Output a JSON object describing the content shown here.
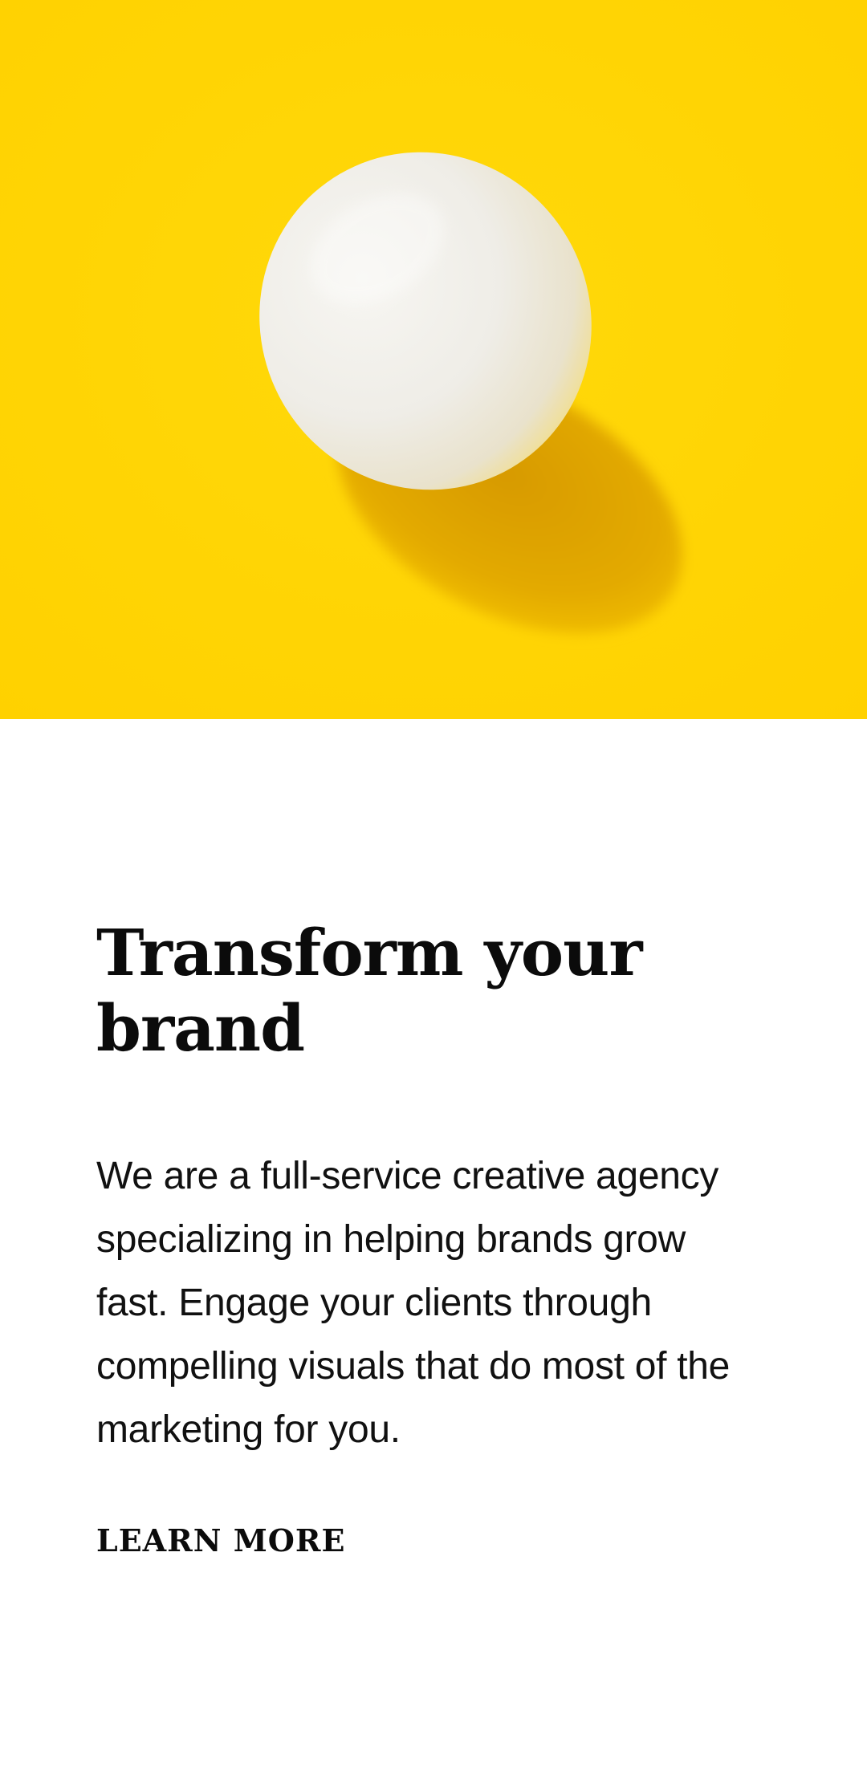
{
  "hero": {
    "image_name": "egg-on-yellow-background",
    "background_color": "#FFD400",
    "egg_color": "#F3F1EC",
    "shadow_color": "#E0A900"
  },
  "section": {
    "headline": "Transform your brand",
    "body": "We are a full-service creative agency specializing in helping brands grow fast. Engage your clients through compelling visuals that do most of the marketing for you.",
    "cta_label": "LEARN MORE"
  }
}
